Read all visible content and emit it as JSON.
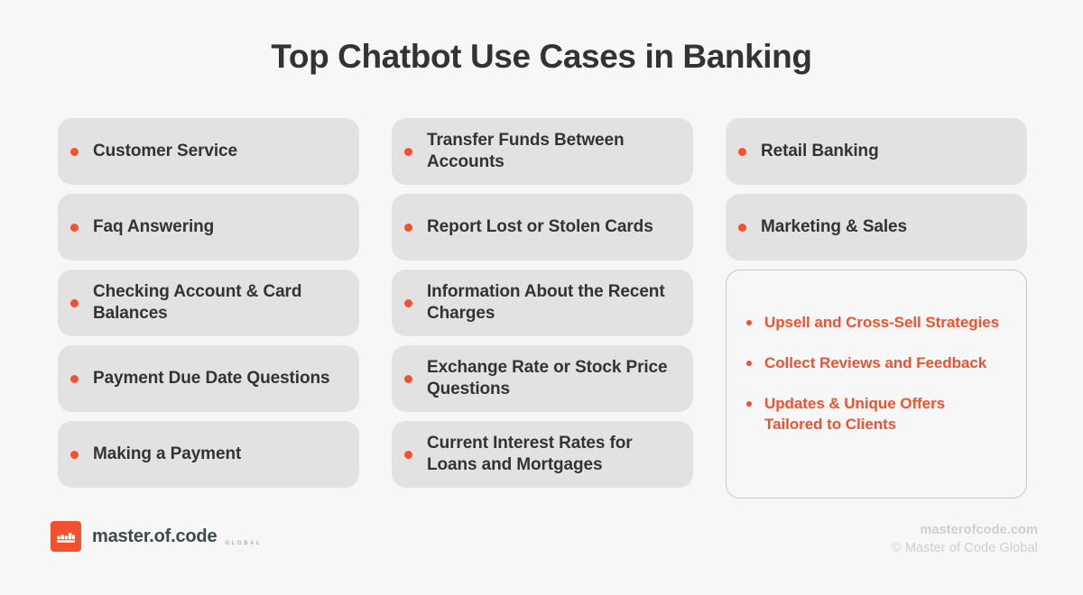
{
  "page": {
    "title": "Top Chatbot Use Cases in Banking",
    "background_color": "#f7f7f7",
    "accent_color": "#f1512f",
    "card_color": "#e2e2e2",
    "text_color": "#333333"
  },
  "columns": [
    {
      "id": "column-1",
      "items": [
        {
          "label": "Customer Service"
        },
        {
          "label": "Faq Answering"
        },
        {
          "label": "Checking Account & Card Balances"
        },
        {
          "label": "Payment Due Date Questions"
        },
        {
          "label": "Making a Payment"
        }
      ]
    },
    {
      "id": "column-2",
      "items": [
        {
          "label": "Transfer Funds Between Accounts"
        },
        {
          "label": "Report Lost or Stolen Cards"
        },
        {
          "label": "Information About the Recent Charges"
        },
        {
          "label": "Exchange Rate or Stock Price Questions"
        },
        {
          "label": "Current Interest Rates for Loans and Mortgages"
        }
      ]
    },
    {
      "id": "column-3",
      "items": [
        {
          "label": "Retail Banking"
        },
        {
          "label": "Marketing & Sales"
        }
      ],
      "subpanel": {
        "items": [
          {
            "label": "Upsell and Cross-Sell Strategies"
          },
          {
            "label": "Collect Reviews and Feedback"
          },
          {
            "label": "Updates & Unique Offers Tailored to Clients"
          }
        ]
      }
    }
  ],
  "footer": {
    "logo": {
      "icon": "crown-icon",
      "name": "master.of.code",
      "sub": "GLOBAL"
    },
    "site": "masterofcode.com",
    "copyright": "© Master of Code Global"
  }
}
